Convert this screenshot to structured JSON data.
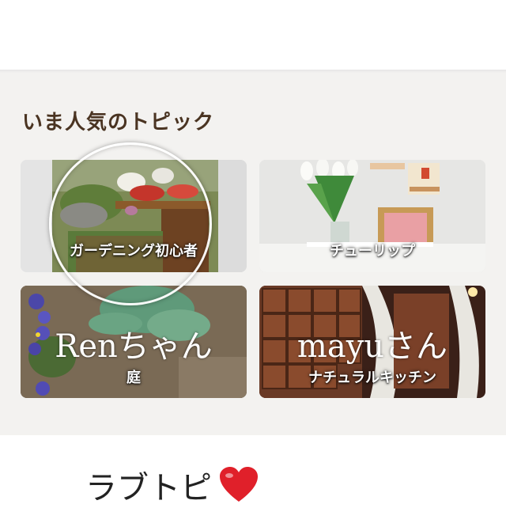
{
  "section": {
    "title": "いま人気のトピック"
  },
  "topics": [
    {
      "label": "ガーデニング初心者",
      "handwriting": ""
    },
    {
      "label": "チューリップ",
      "handwriting": ""
    },
    {
      "label": "庭",
      "handwriting": "Renちゃん"
    },
    {
      "label": "ナチュラルキッチン",
      "handwriting": "mayuさん"
    }
  ],
  "footer": {
    "text": "ラブトピ",
    "icon": "heart-icon",
    "heart_color": "#e0202a"
  },
  "colors": {
    "section_bg": "#f3f2f0",
    "title_color": "#4a3422"
  }
}
